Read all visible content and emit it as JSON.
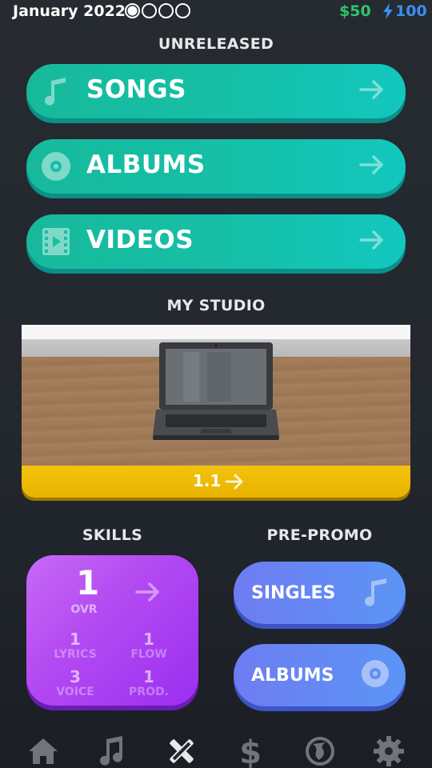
{
  "header": {
    "date": "January 2022",
    "week_progress": {
      "filled": 1,
      "total": 4
    },
    "money": "$50",
    "energy": "100"
  },
  "unreleased": {
    "title": "UNRELEASED",
    "buttons": [
      {
        "label": "SONGS",
        "icon": "music-note-icon"
      },
      {
        "label": "ALBUMS",
        "icon": "disc-icon"
      },
      {
        "label": "VIDEOS",
        "icon": "film-icon"
      }
    ]
  },
  "studio": {
    "title": "MY STUDIO",
    "level": "1.1",
    "image": "laptop-on-desk"
  },
  "skills": {
    "title": "SKILLS",
    "ovr_value": "1",
    "ovr_label": "OVR",
    "stats": [
      {
        "value": "1",
        "label": "LYRICS"
      },
      {
        "value": "1",
        "label": "FLOW"
      },
      {
        "value": "3",
        "label": "VOICE"
      },
      {
        "value": "1",
        "label": "PROD."
      }
    ]
  },
  "pre_promo": {
    "title": "PRE-PROMO",
    "buttons": [
      {
        "label": "SINGLES",
        "icon": "music-note-icon"
      },
      {
        "label": "ALBUMS",
        "icon": "disc-icon"
      }
    ]
  },
  "nav": {
    "items": [
      "home-icon",
      "music-icon",
      "studio-tools-icon",
      "dollar-icon",
      "globe-icon",
      "settings-gear-icon"
    ],
    "active": "studio-tools-icon"
  },
  "colors": {
    "teal": "#16bfa6",
    "purple": "#b44bf2",
    "blue": "#5b95f5",
    "gold": "#f1c30c",
    "money_green": "#2fc46a",
    "energy_blue": "#3b8ff0"
  }
}
